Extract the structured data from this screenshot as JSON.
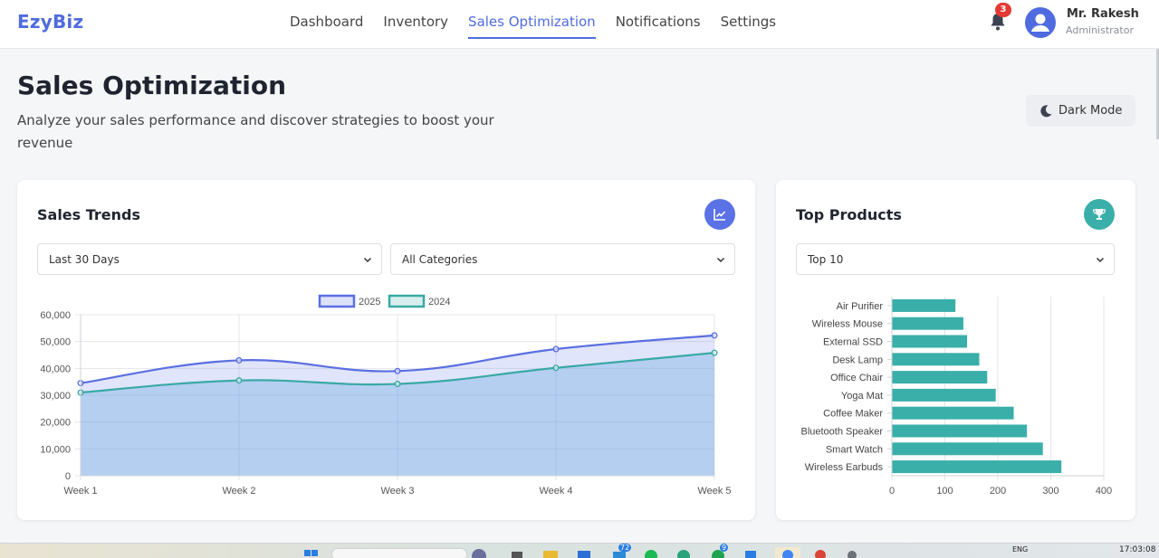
{
  "app": {
    "logo": "EzyBiz",
    "nav": [
      "Dashboard",
      "Inventory",
      "Sales Optimization",
      "Notifications",
      "Settings"
    ],
    "active_nav": "Sales Optimization",
    "notifications_count": "3",
    "user": {
      "name": "Mr. Rakesh",
      "role": "Administrator"
    }
  },
  "page": {
    "title": "Sales Optimization",
    "subtitle": "Analyze your sales performance and discover strategies to boost your revenue",
    "dark_mode_label": "Dark Mode"
  },
  "trends": {
    "title": "Sales Trends",
    "period_select": "Last 30 Days",
    "category_select": "All Categories"
  },
  "top_products": {
    "title": "Top Products",
    "top_select": "Top 10"
  },
  "taskbar": {
    "lang": "ENG",
    "time": "17:03:08",
    "badge_a": "72",
    "badge_b": "9"
  },
  "colors": {
    "accent": "#4f6bdf",
    "teal": "#3aafa9",
    "series_2025": "#5a6fe0",
    "series_2024": "#3aa9a6"
  },
  "chart_data": [
    {
      "type": "area",
      "x": [
        "Week 1",
        "Week 2",
        "Week 3",
        "Week 4",
        "Week 5"
      ],
      "series": [
        {
          "name": "2025",
          "values": [
            34500,
            43000,
            39000,
            47200,
            52300
          ]
        },
        {
          "name": "2024",
          "values": [
            31000,
            35500,
            34200,
            40200,
            45800
          ]
        }
      ],
      "ylim": [
        0,
        60000
      ],
      "yticks": [
        "0",
        "10,000",
        "20,000",
        "30,000",
        "40,000",
        "50,000",
        "60,000"
      ],
      "legend": "top",
      "grid": true
    },
    {
      "type": "bar",
      "orientation": "horizontal",
      "categories": [
        "Air Purifier",
        "Wireless Mouse",
        "External SSD",
        "Desk Lamp",
        "Office Chair",
        "Yoga Mat",
        "Coffee Maker",
        "Bluetooth Speaker",
        "Smart Watch",
        "Wireless Earbuds"
      ],
      "values": [
        120,
        135,
        142,
        165,
        180,
        196,
        230,
        255,
        285,
        320
      ],
      "xlim": [
        0,
        400
      ],
      "xticks": [
        "0",
        "100",
        "200",
        "300",
        "400"
      ],
      "grid": true
    }
  ]
}
